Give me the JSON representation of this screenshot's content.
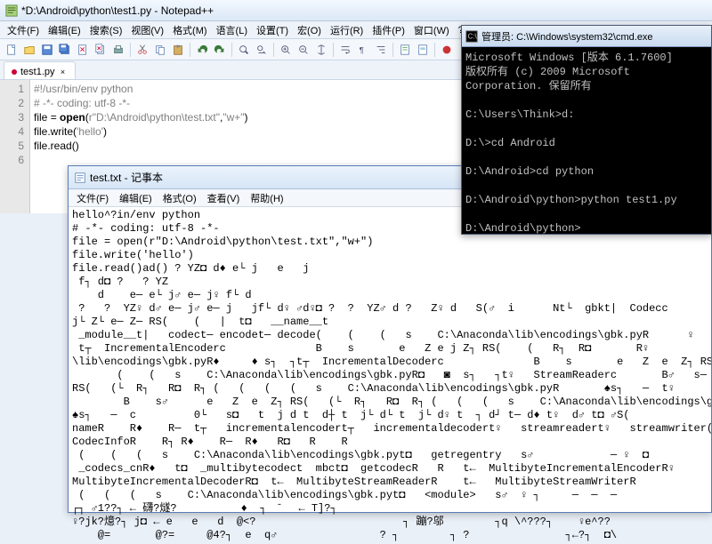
{
  "npp": {
    "title": "*D:\\Android\\python\\test1.py - Notepad++",
    "menu": [
      "文件(F)",
      "编辑(E)",
      "搜索(S)",
      "视图(V)",
      "格式(M)",
      "语言(L)",
      "设置(T)",
      "宏(O)",
      "运行(R)",
      "插件(P)",
      "窗口(W)",
      "?"
    ],
    "tab": {
      "label": "test1.py",
      "dirty": true
    },
    "lines": [
      "1",
      "2",
      "3",
      "4",
      "5",
      "6"
    ],
    "code": {
      "l1a": "#!/usr/bin/env python",
      "l2a": "# -*- coding: utf-8 -*-",
      "l3a": "file ",
      "l3b": "=",
      "l3c": " open",
      "l3d": "(",
      "l3e": "r\"D:\\Android\\python\\test.txt\"",
      "l3f": ",",
      "l3g": "\"w+\"",
      "l3h": ")",
      "l4a": "file.write",
      "l4b": "(",
      "l4c": "'hello'",
      "l4d": ")",
      "l5a": "file.read",
      "l5b": "(",
      "l5c": ")"
    }
  },
  "notepad": {
    "title": "test.txt - 记事本",
    "menu": [
      "文件(F)",
      "编辑(E)",
      "格式(O)",
      "查看(V)",
      "帮助(H)"
    ],
    "body": "hello^?in/env python\n# -*- coding: utf-8 -*-\nfile = open(r\"D:\\Android\\python\\test.txt\",\"w+\")\nfile.write('hello')\nfile.read()ad() ? YZ◘ d♦ e└ j   e   j\n f┐ d◘ ?   ? YZ\n    d    e─ e└ j♂ e─ j♀ f└ d\n ?   ?  YZ♀ d♂ e─ j♂ e─ j   jf└ d♀ ♂d♀◘ ?  ?  YZ♂ d ?   Z♀ d   S(♂  i      Nt└  gbkt|  Codecc\nj└ Z└ e─ Z─ RS(    (   |  t◘   __name__t\n _module__t|   codect─ encodet─ decode(    (    (   s    C:\\Anaconda\\lib\\encodings\\gbk.pyR      ♀\n t┬  IncrementalEncoderc              B    s       e   Z e j Z┐ RS(    (   R┐  R◘       R♀\n\\lib\\encodings\\gbk.pyR♦     ♦ s┐  ┐t┬  IncrementalDecoderc              B    s       e   Z  e  Z┐ RS(   (└\n       (    (   s    C:\\Anaconda\\lib\\encodings\\gbk.pyR◘   ◙  s┐   ┐t♀   StreamReaderc       B♂   s─\nRS(   (└  R┐   R◘  R┐ (   (   (   (   s    C:\\Anaconda\\lib\\encodings\\gbk.pyR       ♠s┐   ─  t♀\n        B    s♂      e   Z  e  Z┐ RS(   (└  R┐   R◘  R┐ (   (   (   s    C:\\Anaconda\\lib\\encodings\\g\n♠s┐   ─  c         0└   s◘   t  j d t  d┼ t  j└ d└ t  j└ d♀ t  ┐ d┘ t─ d♦ t♀  d♂ t◘ ♂S(\nnameR    R♦    R─  t┬   incrementalencodert┬   incrementaldecodert♀   streamreadert♀   streamwriter(\nCodecInfoR    R┐ R♦    R─  R♦   R◘   R    R\n (    (   (   s    C:\\Anaconda\\lib\\encodings\\gbk.pyt◘   getregentry   s♂            ─ ♀  ◘\n _codecs_cnR♦   t◘  _multibytecodect  mbct◘  getcodecR   R   t←  MultibyteIncrementalEncoderR♀\nMultibyteIncrementalDecoderR◘  t←  MultibyteStreamReaderR    t←   MultibyteStreamWriterR\n (   (   (   s    C:\\Anaconda\\lib\\encodings\\gbk.pyt◘   <module>   s♂  ♀ ┐     ─  ─  ─\n┌┐ ♂1??┐ ← 礴?燧?          ♦  ┐  ̄   ← T]?┐    \n♀?jk?燱?┐ j◘ ← e   e   d  @<?                       ┐ 蹦?邬        ┐q \\^???┐    ♀e^??\n    @=       @?=     @4?┐  e  q♂                ? ┐        ┐ ?               ┐←?┐  ◘\\"
  },
  "cmd": {
    "title": "管理员: C:\\Windows\\system32\\cmd.exe",
    "body": "Microsoft Windows [版本 6.1.7600]\n版权所有 (c) 2009 Microsoft Corporation. 保留所有\n\nC:\\Users\\Think>d:\n\nD:\\>cd Android\n\nD:\\Android>cd python\n\nD:\\Android\\python>python test1.py\n\nD:\\Android\\python>"
  }
}
